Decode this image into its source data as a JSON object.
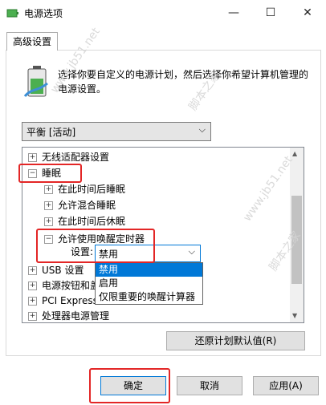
{
  "window": {
    "title": "电源选项",
    "controls": {
      "minimize": "—",
      "maximize": "☐",
      "close": "✕"
    }
  },
  "tabs": [
    {
      "label": "高级设置"
    }
  ],
  "description": "选择你要自定义的电源计划，然后选择你希望计算机管理的电源设置。",
  "plan": {
    "value": "平衡 [活动]"
  },
  "tree": [
    {
      "label": "无线适配器设置",
      "expander": "+"
    },
    {
      "label": "睡眠",
      "expander": "−"
    },
    {
      "label": "在此时间后睡眠",
      "expander": "+"
    },
    {
      "label": "允许混合睡眠",
      "expander": "+"
    },
    {
      "label": "在此时间后休眠",
      "expander": "+"
    },
    {
      "label": "允许使用唤醒定时器",
      "expander": "−"
    },
    {
      "label": "USB 设置",
      "expander": "+"
    },
    {
      "label": "电源按钮和盖",
      "expander": "+"
    },
    {
      "label": "PCI Express",
      "expander": "+"
    },
    {
      "label": "处理器电源管理",
      "expander": "+"
    }
  ],
  "setting": {
    "label": "设置:",
    "value": "禁用",
    "options": [
      "禁用",
      "启用",
      "仅限重要的唤醒计算器"
    ]
  },
  "buttons": {
    "restore": "还原计划默认值(R)",
    "ok": "确定",
    "cancel": "取消",
    "apply": "应用(A)"
  },
  "watermark": {
    "text1": "脚本之家",
    "text2": "www.jb51.net"
  }
}
